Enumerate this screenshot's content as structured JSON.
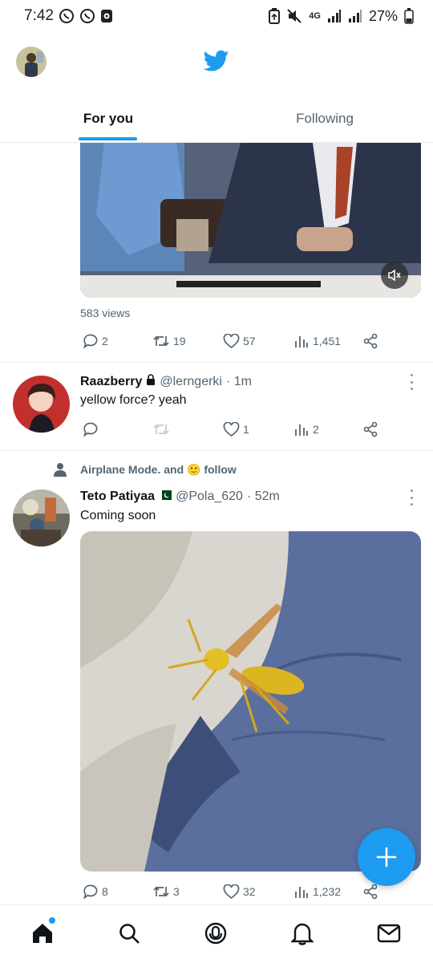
{
  "status_bar": {
    "time": "7:42",
    "network": "4G",
    "battery": "27%",
    "left_icons": [
      "whatsapp-icon",
      "whatsapp-icon",
      "screen-record-icon"
    ],
    "right_icons": [
      "battery-saver-icon",
      "mute-icon",
      "signal-icon",
      "signal-icon",
      "battery-icon"
    ]
  },
  "header": {
    "logo": "twitter-bird-icon",
    "tabs": [
      {
        "label": "For you",
        "active": true
      },
      {
        "label": "Following",
        "active": false
      }
    ]
  },
  "posts": [
    {
      "media": "video-still",
      "views": "583 views",
      "actions": {
        "replies": "2",
        "retweets": "19",
        "likes": "57",
        "views": "1,451"
      }
    },
    {
      "name": "Raazberry",
      "protected": true,
      "handle": "@lerngerki",
      "time": "· 1m",
      "text": "yellow force? yeah",
      "actions": {
        "replies": "",
        "retweets": "",
        "likes": "1",
        "views": "2"
      }
    },
    {
      "social_context": "Airplane Mode. and 🙂 follow",
      "name": "Teto Patiyaa",
      "flag": "pakistan-flag-icon",
      "handle": "@Pola_620",
      "time": "· 52m",
      "text": "Coming soon",
      "media": "wasp-photo",
      "actions": {
        "replies": "8",
        "retweets": "3",
        "likes": "32",
        "views": "1,232"
      }
    }
  ],
  "bottom_nav": [
    "home-icon",
    "search-icon",
    "spaces-icon",
    "notifications-icon",
    "messages-icon"
  ],
  "colors": {
    "accent": "#1d9bf0",
    "text": "#0f1419",
    "secondary": "#536471",
    "divider": "#e6ecf0"
  }
}
